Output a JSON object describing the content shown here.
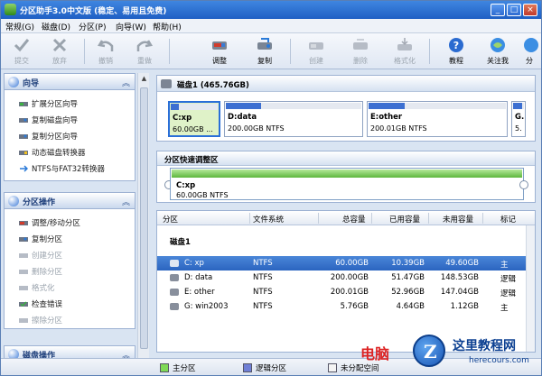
{
  "window": {
    "title": "分区助手3.0中文版 (稳定、易用且免费)",
    "minimize": "_",
    "maximize": "□",
    "close": "×"
  },
  "menu": [
    "常规(G)",
    "磁盘(D)",
    "分区(P)",
    "向导(W)",
    "帮助(H)"
  ],
  "toolbar": [
    {
      "label": "提交",
      "icon": "check-icon",
      "enabled": false
    },
    {
      "label": "放弃",
      "icon": "discard-icon",
      "enabled": false
    },
    {
      "label": "撤销",
      "icon": "undo-icon",
      "enabled": false
    },
    {
      "label": "重做",
      "icon": "redo-icon",
      "enabled": false
    },
    {
      "label": "调整",
      "icon": "resize-icon",
      "enabled": true
    },
    {
      "label": "复制",
      "icon": "copy-disk-icon",
      "enabled": true
    },
    {
      "label": "创建",
      "icon": "create-icon",
      "enabled": false
    },
    {
      "label": "删除",
      "icon": "delete-icon",
      "enabled": false
    },
    {
      "label": "格式化",
      "icon": "format-icon",
      "enabled": false
    },
    {
      "label": "教程",
      "icon": "help-icon",
      "enabled": true
    },
    {
      "label": "关注我",
      "icon": "follow-icon",
      "enabled": true
    },
    {
      "label": "分",
      "icon": "share-icon",
      "enabled": true
    }
  ],
  "sidebar": {
    "wizard": {
      "title": "向导",
      "items": [
        {
          "label": "扩展分区向导",
          "enabled": true
        },
        {
          "label": "复制磁盘向导",
          "enabled": true
        },
        {
          "label": "复制分区向导",
          "enabled": true
        },
        {
          "label": "动态磁盘转换器",
          "enabled": true
        },
        {
          "label": "NTFS与FAT32转换器",
          "enabled": true
        }
      ]
    },
    "partition_ops": {
      "title": "分区操作",
      "items": [
        {
          "label": "调整/移动分区",
          "enabled": true
        },
        {
          "label": "复制分区",
          "enabled": true
        },
        {
          "label": "创建分区",
          "enabled": false
        },
        {
          "label": "删除分区",
          "enabled": false
        },
        {
          "label": "格式化",
          "enabled": false
        },
        {
          "label": "检查错误",
          "enabled": true
        },
        {
          "label": "擦除分区",
          "enabled": false
        }
      ]
    },
    "disk_ops": {
      "title": "磁盘操作"
    }
  },
  "disk": {
    "title": "磁盘1 (465.76GB)",
    "partitions": [
      {
        "name": "C:xp",
        "size": "60.00GB ...",
        "used_fraction": 0.17,
        "color": "#3c6fd1",
        "selected": true
      },
      {
        "name": "D:data",
        "size": "200.00GB NTFS",
        "used_fraction": 0.26,
        "color": "#3c6fd1",
        "selected": false
      },
      {
        "name": "E:other",
        "size": "200.01GB NTFS",
        "used_fraction": 0.26,
        "color": "#3c6fd1",
        "selected": false
      },
      {
        "name": "G.",
        "size": "5.",
        "used_fraction": 0.8,
        "color": "#3c6fd1",
        "selected": false
      }
    ]
  },
  "quick": {
    "title": "分区快速调整区",
    "name": "C:xp",
    "size": "60.00GB NTFS"
  },
  "table": {
    "headers": [
      "分区",
      "文件系统",
      "总容量",
      "已用容量",
      "未用容量",
      "标记"
    ],
    "group": "磁盘1",
    "rows": [
      {
        "part": "C: xp",
        "fs": "NTFS",
        "total": "60.00GB",
        "used": "10.39GB",
        "free": "49.60GB",
        "flag": "主",
        "selected": true
      },
      {
        "part": "D: data",
        "fs": "NTFS",
        "total": "200.00GB",
        "used": "51.47GB",
        "free": "148.53GB",
        "flag": "逻辑",
        "selected": false
      },
      {
        "part": "E: other",
        "fs": "NTFS",
        "total": "200.01GB",
        "used": "52.96GB",
        "free": "147.04GB",
        "flag": "逻辑",
        "selected": false
      },
      {
        "part": "G: win2003",
        "fs": "NTFS",
        "total": "5.76GB",
        "used": "4.64GB",
        "free": "1.12GB",
        "flag": "主",
        "selected": false
      }
    ]
  },
  "legend": [
    {
      "label": "主分区",
      "color": "#7ed957"
    },
    {
      "label": "逻辑分区",
      "color": "#6f7fd6"
    },
    {
      "label": "未分配空间",
      "color": "#f4f4f4"
    }
  ],
  "watermark": {
    "red_text": "电脑",
    "site_name": "这里教程网",
    "site_url": "herecours.com",
    "logo_letter": "Z"
  }
}
